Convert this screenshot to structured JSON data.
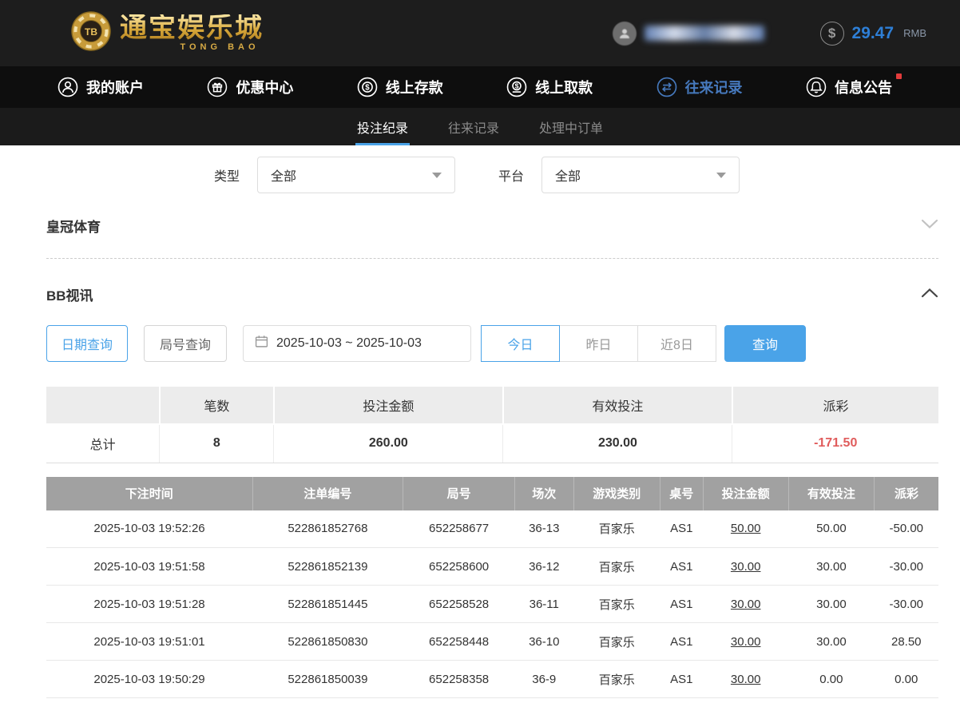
{
  "header": {
    "logo": {
      "chip_text": "TB",
      "title": "通宝娱乐城",
      "subtitle": "TONG BAO"
    },
    "balance": {
      "currency_symbol": "$",
      "amount": "29.47",
      "unit": "RMB"
    }
  },
  "nav": {
    "items": [
      {
        "label": "我的账户"
      },
      {
        "label": "优惠中心"
      },
      {
        "label": "线上存款"
      },
      {
        "label": "线上取款"
      },
      {
        "label": "往来记录"
      },
      {
        "label": "信息公告"
      }
    ]
  },
  "tabs": {
    "items": [
      {
        "label": "投注纪录"
      },
      {
        "label": "往来记录"
      },
      {
        "label": "处理中订单"
      }
    ]
  },
  "filters": {
    "type_label": "类型",
    "type_value": "全部",
    "platform_label": "平台",
    "platform_value": "全部"
  },
  "sections": {
    "crown_title": "皇冠体育",
    "bb_title": "BB视讯"
  },
  "query": {
    "date_query_btn": "日期查询",
    "round_query_btn": "局号查询",
    "date_range": "2025-10-03 ~ 2025-10-03",
    "today_btn": "今日",
    "yesterday_btn": "昨日",
    "last8_btn": "近8日",
    "search_btn": "查询"
  },
  "summary": {
    "headers": {
      "count": "笔数",
      "bet": "投注金额",
      "valid": "有效投注",
      "payout": "派彩"
    },
    "total_label": "总计",
    "count": "8",
    "bet": "260.00",
    "valid": "230.00",
    "payout": "-171.50"
  },
  "bet_table": {
    "headers": [
      "下注时间",
      "注单编号",
      "局号",
      "场次",
      "游戏类别",
      "桌号",
      "投注金额",
      "有效投注",
      "派彩"
    ],
    "rows": [
      {
        "time": "2025-10-03 19:52:26",
        "bet_id": "522861852768",
        "round": "652258677",
        "session": "36-13",
        "game": "百家乐",
        "table_no": "AS1",
        "bet": "50.00",
        "valid": "50.00",
        "payout": "-50.00"
      },
      {
        "time": "2025-10-03 19:51:58",
        "bet_id": "522861852139",
        "round": "652258600",
        "session": "36-12",
        "game": "百家乐",
        "table_no": "AS1",
        "bet": "30.00",
        "valid": "30.00",
        "payout": "-30.00"
      },
      {
        "time": "2025-10-03 19:51:28",
        "bet_id": "522861851445",
        "round": "652258528",
        "session": "36-11",
        "game": "百家乐",
        "table_no": "AS1",
        "bet": "30.00",
        "valid": "30.00",
        "payout": "-30.00"
      },
      {
        "time": "2025-10-03 19:51:01",
        "bet_id": "522861850830",
        "round": "652258448",
        "session": "36-10",
        "game": "百家乐",
        "table_no": "AS1",
        "bet": "30.00",
        "valid": "30.00",
        "payout": "28.50"
      },
      {
        "time": "2025-10-03 19:50:29",
        "bet_id": "522861850039",
        "round": "652258358",
        "session": "36-9",
        "game": "百家乐",
        "table_no": "AS1",
        "bet": "30.00",
        "valid": "0.00",
        "payout": "0.00"
      }
    ]
  },
  "colors": {
    "accent_blue": "#4aa3e8",
    "negative_red": "#e05c5c",
    "nav_active_blue": "#4679bd",
    "gold": "#d8ab45"
  }
}
